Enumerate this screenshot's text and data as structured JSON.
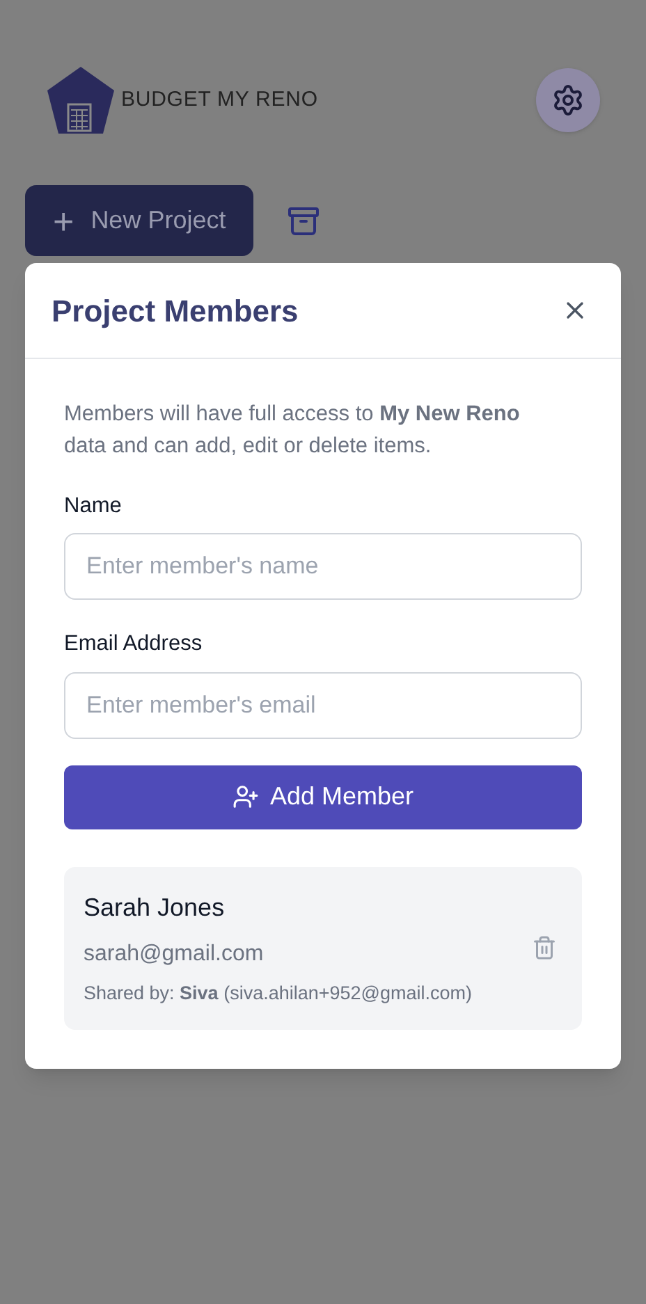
{
  "header": {
    "logo_text": "BUDGET MY RENO"
  },
  "toolbar": {
    "new_project": {
      "icon": "+",
      "label": "New Project"
    }
  },
  "dialog": {
    "title": "Project Members",
    "intro": "Members will have full access to **My New Reno** data and can add, edit or delete items.",
    "fields": [
      {
        "label": "Name",
        "placeholder": "Enter member's name"
      },
      {
        "label": "Email Address",
        "placeholder": "Enter member's email"
      }
    ],
    "add_button": "Add Member",
    "members": [
      {
        "name": "Sarah Jones",
        "email": "sarah@gmail.com",
        "shared_by": "Shared by: **Siva** (siva.ahilan+952@gmail.com)"
      }
    ]
  }
}
